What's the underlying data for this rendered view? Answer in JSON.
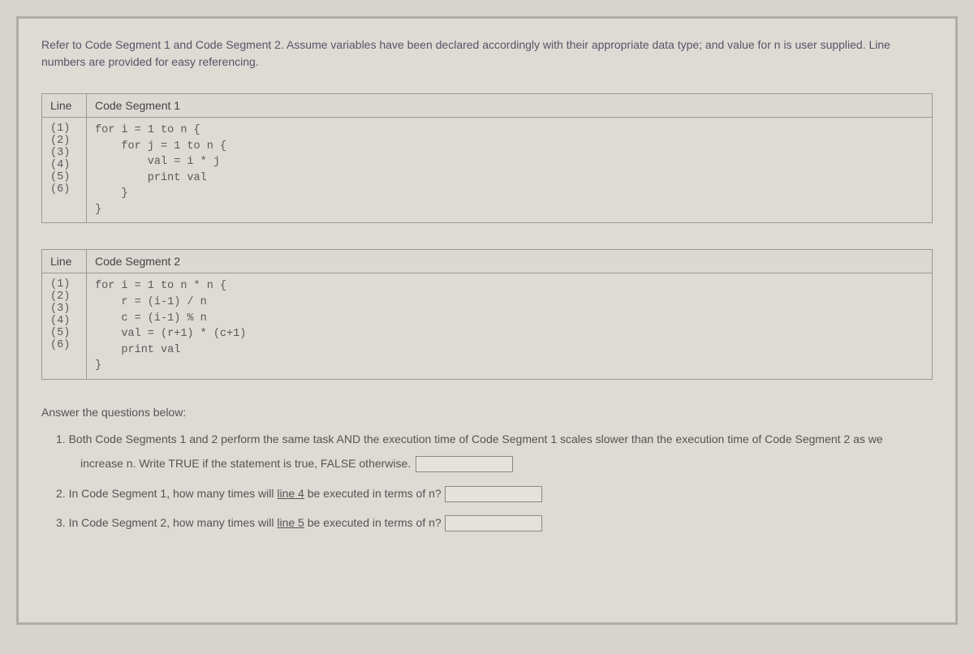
{
  "intro": "Refer to Code Segment 1 and Code Segment 2. Assume variables have been declared accordingly with their appropriate data type; and value for n is user supplied. Line numbers are provided for easy referencing.",
  "table1": {
    "headers": {
      "col1": "Line",
      "col2": "Code Segment 1"
    },
    "lineNumbers": "(1)\n(2)\n(3)\n(4)\n(5)\n(6)",
    "code": "for i = 1 to n {\n    for j = 1 to n {\n        val = i * j\n        print val\n    }\n}"
  },
  "table2": {
    "headers": {
      "col1": "Line",
      "col2": "Code Segment 2"
    },
    "lineNumbers": "(1)\n(2)\n(3)\n(4)\n(5)\n(6)",
    "code": "for i = 1 to n * n {\n    r = (i-1) / n\n    c = (i-1) % n\n    val = (r+1) * (c+1)\n    print val\n}"
  },
  "questions": {
    "header": "Answer the questions below:",
    "q1_part1": "1. Both Code Segments 1 and 2 perform the same task AND the execution time of Code Segment 1 scales slower than the execution time of Code Segment 2 as we",
    "q1_part2": "increase n. Write TRUE if the statement is true, FALSE otherwise.",
    "q2_pre": "2. In Code Segment 1, how many times will ",
    "q2_line": "line 4",
    "q2_post": " be executed in terms of n?",
    "q3_pre": "3. In Code Segment 2, how many times will ",
    "q3_line": "line 5",
    "q3_post": " be executed in terms of n?"
  }
}
